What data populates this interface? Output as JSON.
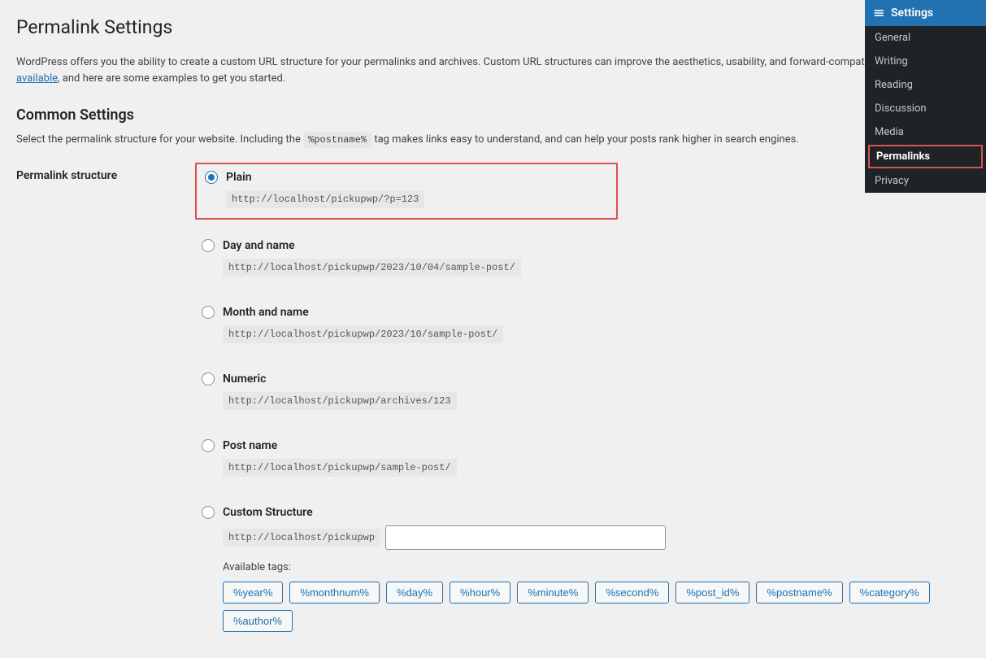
{
  "page": {
    "title": "Permalink Settings",
    "intro_text_1": "WordPress offers you the ability to create a custom URL structure for your permalinks and archives. Custom URL structures can improve the aesthetics, usability, and forward-compatib",
    "intro_link": "number of tags are available",
    "intro_text_2": ", and here are some examples to get you started.",
    "common_title": "Common Settings",
    "common_desc_1": "Select the permalink structure for your website. Including the ",
    "postname_tag": "%postname%",
    "common_desc_2": " tag makes links easy to understand, and can help your posts rank higher in search engines.",
    "row_label": "Permalink structure",
    "available_tags_label": "Available tags:"
  },
  "options": {
    "plain": {
      "label": "Plain",
      "example": "http://localhost/pickupwp/?p=123",
      "selected": true
    },
    "day": {
      "label": "Day and name",
      "example": "http://localhost/pickupwp/2023/10/04/sample-post/",
      "selected": false
    },
    "month": {
      "label": "Month and name",
      "example": "http://localhost/pickupwp/2023/10/sample-post/",
      "selected": false
    },
    "numeric": {
      "label": "Numeric",
      "example": "http://localhost/pickupwp/archives/123",
      "selected": false
    },
    "postname": {
      "label": "Post name",
      "example": "http://localhost/pickupwp/sample-post/",
      "selected": false
    },
    "custom": {
      "label": "Custom Structure",
      "prefix": "http://localhost/pickupwp",
      "value": "",
      "selected": false
    }
  },
  "tags": [
    "%year%",
    "%monthnum%",
    "%day%",
    "%hour%",
    "%minute%",
    "%second%",
    "%post_id%",
    "%postname%",
    "%category%",
    "%author%"
  ],
  "sidebar": {
    "header": "Settings",
    "items": [
      {
        "label": "General",
        "active": false
      },
      {
        "label": "Writing",
        "active": false
      },
      {
        "label": "Reading",
        "active": false
      },
      {
        "label": "Discussion",
        "active": false
      },
      {
        "label": "Media",
        "active": false
      },
      {
        "label": "Permalinks",
        "active": true
      },
      {
        "label": "Privacy",
        "active": false
      }
    ]
  }
}
